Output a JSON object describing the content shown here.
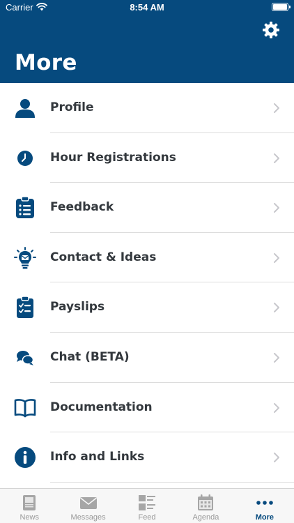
{
  "status_bar": {
    "carrier": "Carrier",
    "time": "8:54 AM"
  },
  "header": {
    "title": "More",
    "settings_icon": "gear-icon"
  },
  "colors": {
    "brand": "#064a7e",
    "text": "#33383d",
    "chevron": "#c7c7cc",
    "tab_inactive": "#999999"
  },
  "menu": {
    "items": [
      {
        "label": "Profile",
        "icon": "person-icon"
      },
      {
        "label": "Hour Registrations",
        "icon": "clock-icon"
      },
      {
        "label": "Feedback",
        "icon": "clipboard-list-icon"
      },
      {
        "label": "Contact & Ideas",
        "icon": "lightbulb-mail-icon"
      },
      {
        "label": "Payslips",
        "icon": "clipboard-check-icon"
      },
      {
        "label": "Chat (BETA)",
        "icon": "chat-bubbles-icon"
      },
      {
        "label": "Documentation",
        "icon": "book-icon"
      },
      {
        "label": "Info and Links",
        "icon": "info-icon"
      }
    ]
  },
  "tabs": [
    {
      "label": "News",
      "icon": "newspaper-icon",
      "active": false
    },
    {
      "label": "Messages",
      "icon": "envelope-icon",
      "active": false
    },
    {
      "label": "Feed",
      "icon": "feed-icon",
      "active": false
    },
    {
      "label": "Agenda",
      "icon": "calendar-icon",
      "active": false
    },
    {
      "label": "More",
      "icon": "more-dots-icon",
      "active": true
    }
  ]
}
